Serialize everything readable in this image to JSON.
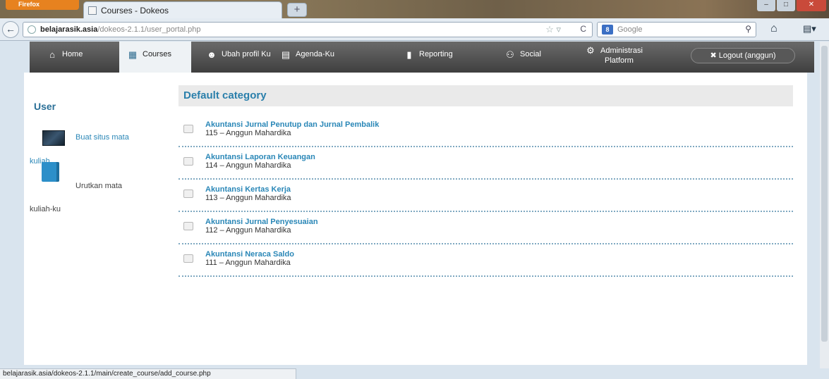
{
  "browser": {
    "menu_button": "Firefox",
    "tab_title": "Courses - Dokeos",
    "new_tab": "+",
    "url_domain": "belajarasik.asia",
    "url_path": "/dokeos-2.1.1/user_portal.php",
    "search_engine": "Google",
    "status_url": "belajarasik.asia/dokeos-2.1.1/main/create_course/add_course.php"
  },
  "menu": {
    "tabs": [
      {
        "label": "Home",
        "icon": "home-icon"
      },
      {
        "label": "Courses",
        "icon": "courses-icon"
      },
      {
        "label": "Ubah profil Ku",
        "icon": "profile-icon"
      },
      {
        "label": "Agenda-Ku",
        "icon": "calendar-icon"
      },
      {
        "label": "Reporting",
        "icon": "reporting-icon"
      },
      {
        "label": "Social",
        "icon": "social-icon"
      },
      {
        "label": "Administrasi",
        "label2": "Platform",
        "icon": "gear-icon"
      }
    ],
    "logout": "Logout (anggun)"
  },
  "sidebar": {
    "title": "User",
    "links": [
      {
        "part1": "Buat situs mata",
        "part2": "kuliah"
      },
      {
        "part1": "Urutkan mata",
        "part2": "kuliah-ku"
      }
    ]
  },
  "main": {
    "category": "Default category",
    "courses": [
      {
        "title": "Akuntansi Jurnal Penutup dan Jurnal Pembalik",
        "info": "115 – Anggun Mahardika"
      },
      {
        "title": "Akuntansi Laporan Keuangan",
        "info": "114 – Anggun Mahardika"
      },
      {
        "title": "Akuntansi Kertas Kerja",
        "info": "113 – Anggun Mahardika"
      },
      {
        "title": "Akuntansi Jurnal Penyesuaian",
        "info": "112 – Anggun Mahardika"
      },
      {
        "title": "Akuntansi Neraca Saldo",
        "info": "111 – Anggun Mahardika"
      }
    ]
  },
  "colors": {
    "link": "#2a87b7",
    "heading": "#2a7fab",
    "menubar": "#4f4f4f"
  }
}
